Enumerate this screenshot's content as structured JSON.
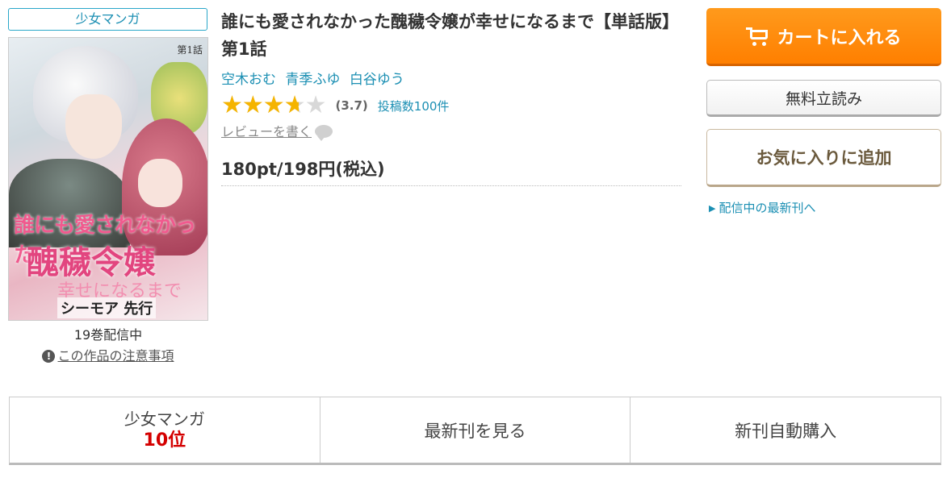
{
  "genre_tag": "少女マンガ",
  "cover": {
    "episode_mark": "第1話",
    "title_line1": "誰にも愛されなかった",
    "title_line2": "醜穢令嬢",
    "title_line3": "幸せになるまで",
    "label": "シーモア 先行"
  },
  "volume_status": "19巻配信中",
  "notice_link": "この作品の注意事項",
  "title": "誰にも愛されなかった醜穢令嬢が幸せになるまで【単話版】 第1話",
  "authors": [
    "空木おむ",
    "青季ふゆ",
    "白谷ゆう"
  ],
  "rating": {
    "stars_text": "★★★★★",
    "value": 3.7,
    "score_label": "(3.7)",
    "count_label": "投稿数100件"
  },
  "review_link": "レビューを書く",
  "price": "180pt/198円(税込)",
  "buttons": {
    "cart": "カートに入れる",
    "sample": "無料立読み",
    "favorite": "お気に入りに追加"
  },
  "latest_link": "配信中の最新刊へ",
  "bottom_bar": {
    "ranking_genre": "少女マンガ",
    "ranking_value": "10位",
    "latest": "最新刊を見る",
    "auto_buy": "新刊自動購入"
  },
  "colors": {
    "accent_link": "#1b8fb3",
    "cart_button": "#ff8a00",
    "rank_red": "#d40000",
    "star": "#f5b400"
  }
}
